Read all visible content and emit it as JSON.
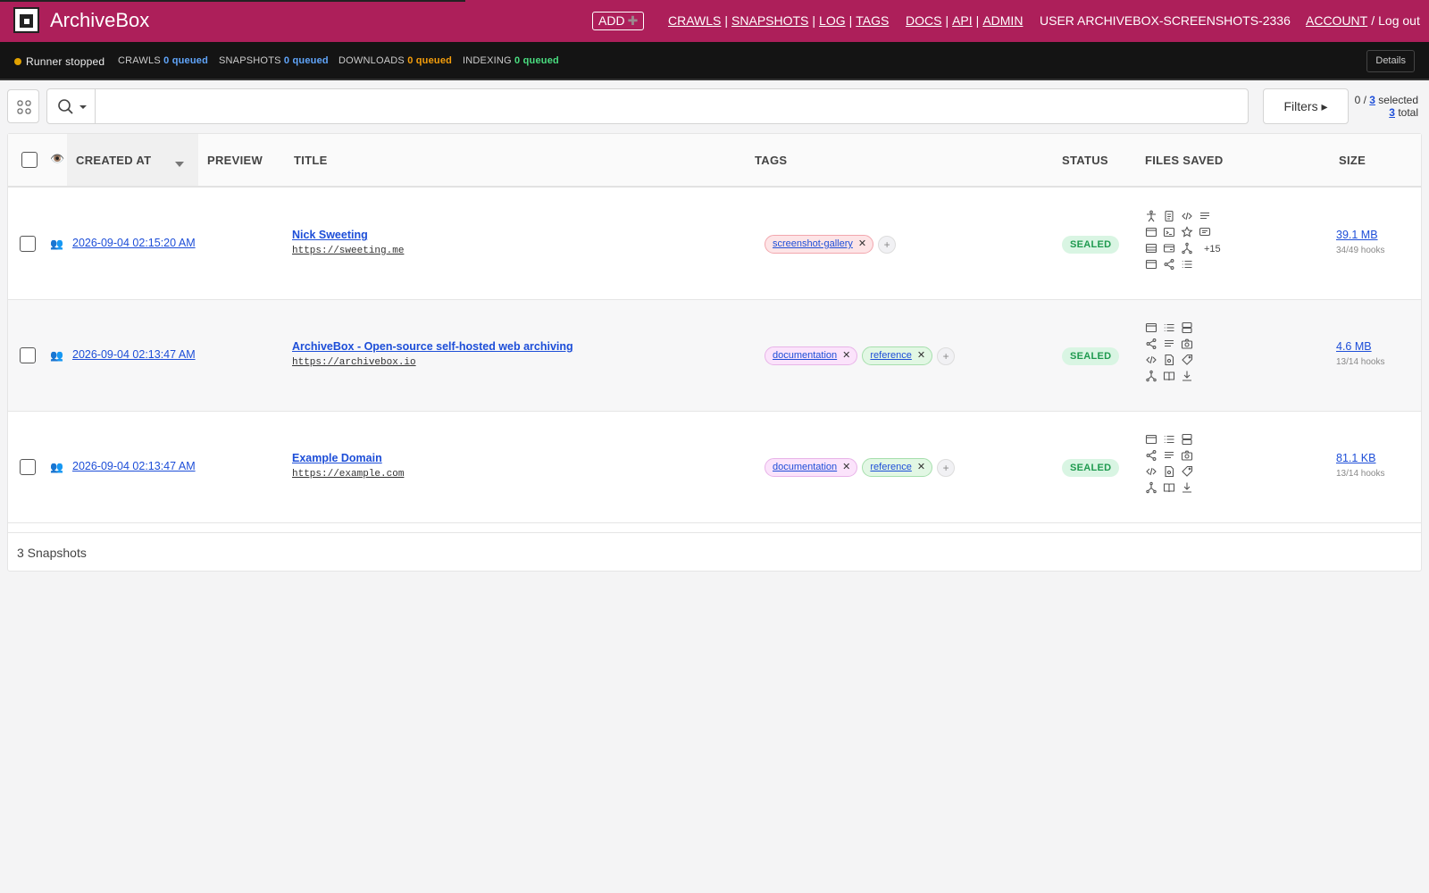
{
  "app": {
    "name": "ArchiveBox",
    "add_label": "ADD",
    "add_icon": "plus-icon",
    "nav_group1": [
      "CRAWLS",
      "SNAPSHOTS",
      "LOG",
      "TAGS"
    ],
    "nav_group2": [
      "DOCS",
      "API",
      "ADMIN"
    ],
    "user_label": "USER ARCHIVEBOX-SCREENSHOTS-2336",
    "account_label": "ACCOUNT",
    "logout_label": "Log out",
    "accent_color": "#ad1f5a"
  },
  "statusbar": {
    "runner": "Runner stopped",
    "crawls_label": "CRAWLS",
    "crawls_q": "0 queued",
    "snapshots_label": "SNAPSHOTS",
    "snapshots_q": "0 queued",
    "downloads_label": "DOWNLOADS",
    "downloads_q": "0 queued",
    "indexing_label": "INDEXING",
    "indexing_q": "0 queued",
    "details_label": "Details"
  },
  "toolbar": {
    "search_placeholder": "",
    "filters_label": "Filters ▸",
    "selected_prefix": "0 / ",
    "selected_count": "3",
    "selected_suffix": " selected",
    "total_count": "3",
    "total_suffix": " total"
  },
  "table": {
    "columns": {
      "created": "CREATED AT",
      "preview": "PREVIEW",
      "title": "TITLE",
      "tags": "TAGS",
      "status": "STATUS",
      "files": "FILES SAVED",
      "size": "SIZE"
    },
    "rows": [
      {
        "created": "2026-09-04 02:15:20 AM",
        "title": "Nick Sweeting",
        "url": "https://sweeting.me",
        "tags": [
          {
            "label": "screenshot-gallery",
            "color": "red"
          }
        ],
        "status": "SEALED",
        "files_more": "+15",
        "size": "39.1 MB",
        "hooks": "34/49 hooks"
      },
      {
        "created": "2026-09-04 02:13:47 AM",
        "title": "ArchiveBox - Open-source self-hosted web archiving",
        "url": "https://archivebox.io",
        "tags": [
          {
            "label": "documentation",
            "color": "purple"
          },
          {
            "label": "reference",
            "color": "green"
          }
        ],
        "status": "SEALED",
        "files_more": "",
        "size": "4.6 MB",
        "hooks": "13/14 hooks"
      },
      {
        "created": "2026-09-04 02:13:47 AM",
        "title": "Example Domain",
        "url": "https://example.com",
        "tags": [
          {
            "label": "documentation",
            "color": "purple"
          },
          {
            "label": "reference",
            "color": "green"
          }
        ],
        "status": "SEALED",
        "files_more": "",
        "size": "81.1 KB",
        "hooks": "13/14 hooks"
      }
    ],
    "footer": "3 Snapshots"
  }
}
